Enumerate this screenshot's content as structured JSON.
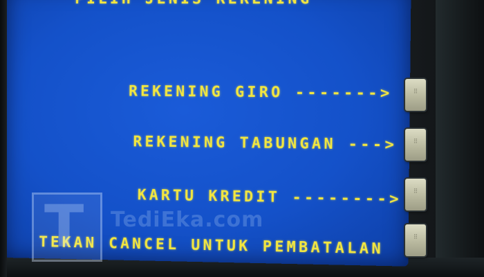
{
  "screen": {
    "heading": "PILIH JENIS REKENING",
    "options": [
      {
        "label": "REKENING GIRO",
        "leader": "-------",
        "arrow": ">"
      },
      {
        "label": "REKENING TABUNGAN",
        "leader": "---",
        "arrow": ">"
      },
      {
        "label": "KARTU KREDIT",
        "leader": "--------",
        "arrow": ">"
      }
    ],
    "cancel_text": "TEKAN CANCEL UNTUK PEMBATALAN"
  },
  "watermark": {
    "letter": "T",
    "text": "TediEka.com"
  },
  "colors": {
    "screen_blue": "#1451c9",
    "text_yellow": "#f2e640"
  }
}
